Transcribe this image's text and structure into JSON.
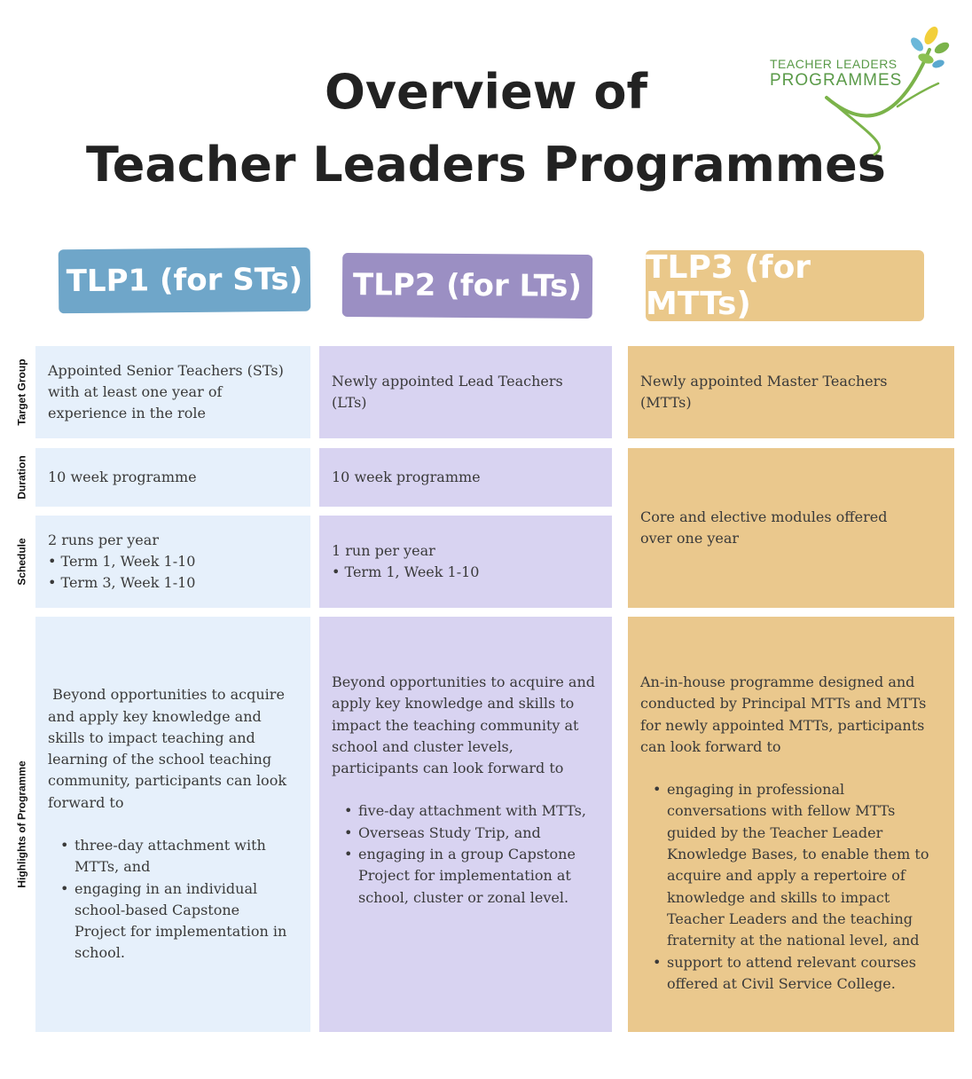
{
  "title": {
    "line1": "Overview of",
    "line2": "Teacher Leaders Programmes"
  },
  "logo": {
    "line1": "TEACHER LEADERS",
    "line2": "PROGRAMMES"
  },
  "columns": [
    {
      "header": "TLP1 (for STs)"
    },
    {
      "header": "TLP2 (for LTs)"
    },
    {
      "header": "TLP3 (for MTTs)"
    }
  ],
  "row_labels": {
    "target_group": "Target Group",
    "duration": "Duration",
    "schedule": "Schedule",
    "highlights": "Highlights of Programme"
  },
  "tlp1": {
    "target_group": [
      "Appointed Senior Teachers (STs)",
      "with at least one year of",
      "experience in the role"
    ],
    "duration": "10 week programme",
    "schedule": [
      "2 runs per year",
      "• Term 1, Week 1-10",
      "• Term 3, Week 1-10"
    ],
    "highlights_intro": [
      " Beyond opportunities to acquire",
      "and apply key knowledge and",
      "skills to impact teaching and",
      "learning of the school teaching",
      "community, participants can look",
      "forward to"
    ],
    "highlights_items": [
      [
        "three-day attachment with",
        "MTTs, and"
      ],
      [
        "engaging in an individual",
        "school-based Capstone",
        "Project for implementation in",
        "school."
      ]
    ]
  },
  "tlp2": {
    "target_group": "Newly appointed Lead Teachers (LTs)",
    "duration": "10 week programme",
    "schedule": [
      "1 run per year",
      "• Term 1, Week 1-10"
    ],
    "highlights_intro": [
      "Beyond opportunities to acquire and",
      "apply key knowledge and skills to",
      "impact the teaching community at",
      "school and cluster levels,",
      "participants can look forward to"
    ],
    "highlights_items": [
      [
        "five-day attachment with MTTs,"
      ],
      [
        "Overseas Study Trip, and"
      ],
      [
        "engaging in a group Capstone",
        "Project for implementation at",
        "school, cluster or zonal level."
      ]
    ]
  },
  "tlp3": {
    "target_group": "Newly appointed Master Teachers (MTTs)",
    "duration_schedule": [
      "Core and elective modules offered",
      "over one year"
    ],
    "highlights_intro": [
      "An-in-house programme designed and",
      "conducted by Principal MTTs and MTTs",
      "for newly appointed MTTs, participants",
      "can look forward to"
    ],
    "highlights_items": [
      [
        "engaging in professional",
        "conversations with fellow MTTs",
        "guided by the Teacher Leader",
        "Knowledge Bases, to enable them to",
        "acquire and apply a repertoire of",
        "knowledge and skills to impact",
        "Teacher Leaders and the teaching",
        "fraternity at the national level, and"
      ],
      [
        "support to attend relevant courses",
        "offered at Civil Service College."
      ]
    ]
  },
  "colors": {
    "tlp1_header": "#6fa6c9",
    "tlp2_header": "#9b8fc3",
    "tlp3_header": "#eac88a",
    "tlp1_cell": "#e6f0fb",
    "tlp2_cell": "#d8d3f1",
    "tlp3_cell": "#eac88d"
  }
}
